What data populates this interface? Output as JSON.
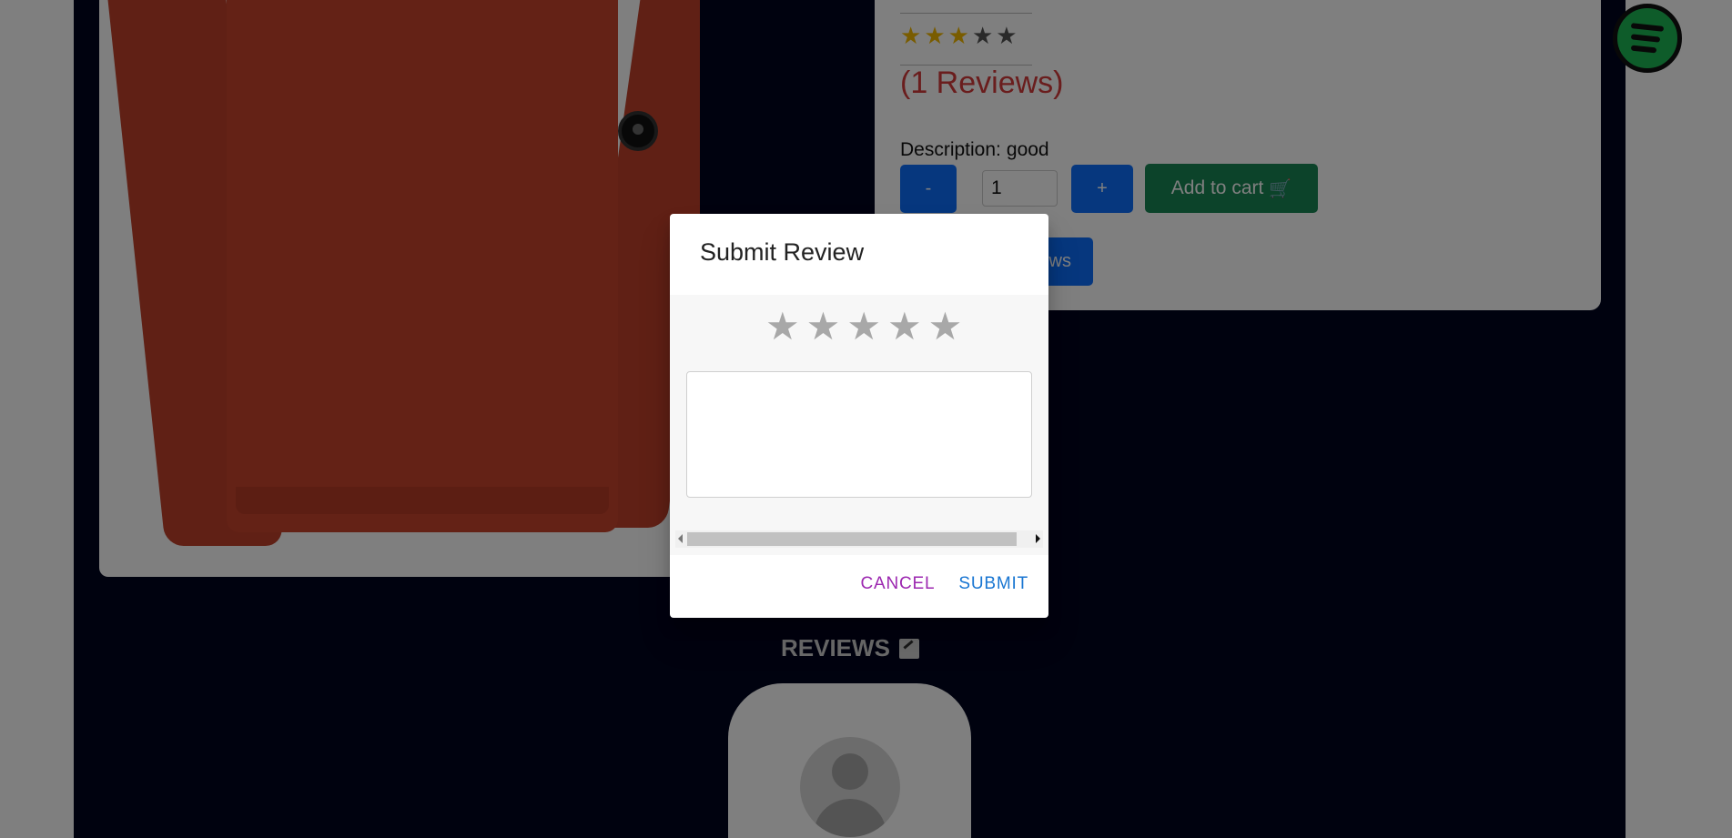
{
  "product": {
    "rating_stars": [
      "★",
      "★",
      "★",
      "★",
      "★"
    ],
    "rating_value": 3,
    "rating_max": 5,
    "reviews_count_text": "(1 Reviews)",
    "description_label": "Description:",
    "description_value": "good",
    "quantity_value": "1",
    "minus_label": "-",
    "plus_label": "+",
    "add_to_cart_label": "Add to cart",
    "cart_icon": "shopping-cart-icon",
    "view_reviews_label": "ws"
  },
  "reviews_section": {
    "heading": "REVIEWS",
    "icon": "rate-review-icon"
  },
  "spotify": {
    "icon": "spotify-icon"
  },
  "modal": {
    "title": "Submit Review",
    "stars": [
      "★",
      "★",
      "★",
      "★",
      "★"
    ],
    "textarea_value": "",
    "cancel_label": "CANCEL",
    "submit_label": "SUBMIT"
  },
  "colors": {
    "page_panel": "#00051f",
    "cart_button": "#198754",
    "primary_button": "#0d6efd",
    "star_filled": "#f2b900",
    "reviews_count": "#d43a3a",
    "cancel": "#9c27b0",
    "submit": "#1976d2",
    "spotify": "#1db954"
  }
}
